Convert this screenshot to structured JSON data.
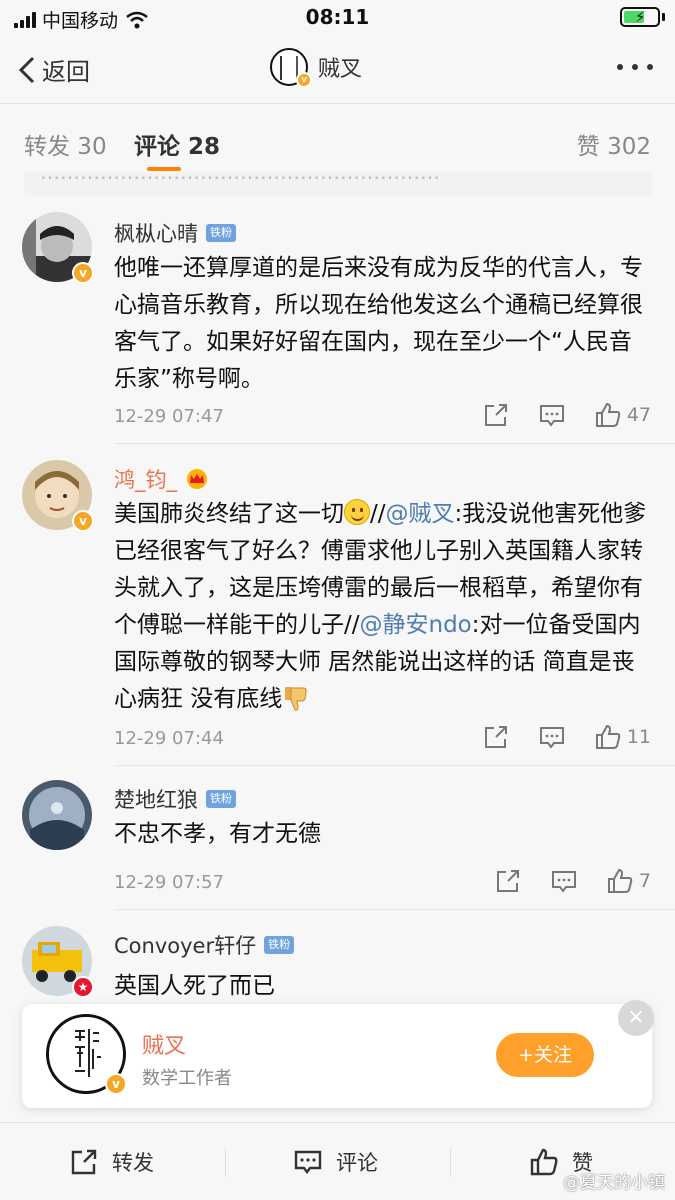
{
  "status_bar": {
    "carrier": "中国移动",
    "time": "08:11"
  },
  "nav": {
    "back_label": "返回",
    "title": "贼叉"
  },
  "tabs": [
    {
      "label": "转发 30"
    },
    {
      "label": "评论 28"
    },
    {
      "label": "赞 302"
    }
  ],
  "comments": [
    {
      "user": "枫枞心晴",
      "badge": "铁粉",
      "text": "他唯一还算厚道的是后来没有成为反华的代言人，专心搞音乐教育，所以现在给他发这么个通稿已经算很客气了。如果好好留在国内，现在至少一个“人民音乐家”称号啊。",
      "time": "12-29 07:47",
      "likes": "47"
    },
    {
      "user": "鸿_钧_",
      "text_part1": "美国肺炎终结了这一切",
      "text_part2": "//",
      "mention1": "@贼叉",
      "text_part3": ":我没说他害死他爹已经很客气了好么？傅雷求他儿子别入英国籍人家转头就入了，这是压垮傅雷的最后一根稻草，希望你有个傅聪一样能干的儿子//",
      "mention2": "@静安ndo",
      "text_part4": ":对一位备受国内国际尊敬的钢琴大师 居然能说出这样的话 简直是丧心病狂 没有底线",
      "time": "12-29 07:44",
      "likes": "11"
    },
    {
      "user": "楚地红狼",
      "badge": "铁粉",
      "text": "不忠不孝，有才无德",
      "time": "12-29 07:57",
      "likes": "7"
    },
    {
      "user": "Convoyer轩仔",
      "badge": "铁粉",
      "text": "英国人死了而已"
    }
  ],
  "popup": {
    "name": "贼叉",
    "subtitle": "数学工作者",
    "follow_label": "+关注",
    "close_glyph": "✕"
  },
  "bottom_bar": {
    "repost": "转发",
    "comment": "评论",
    "like": "赞"
  },
  "watermark": "@夏天的小镇",
  "colors": {
    "accent": "#ff8200",
    "link": "#507daf",
    "vip_name": "#eb7350",
    "fan_badge": "#6fa3e0"
  }
}
